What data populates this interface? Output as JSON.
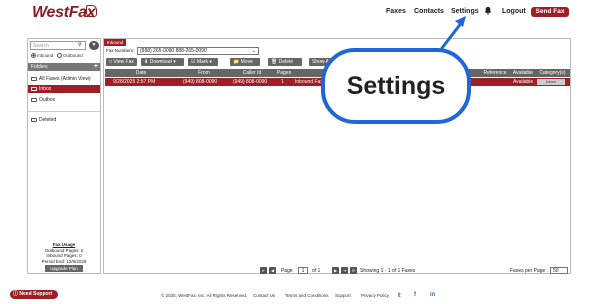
{
  "header": {
    "logo": "WestFax",
    "nav": {
      "faxes": "Faxes",
      "contacts": "Contacts",
      "settings": "Settings",
      "logout": "Logout"
    },
    "send_fax": "Send Fax",
    "bell_icon": "bell-icon"
  },
  "sidebar": {
    "search_placeholder": "Search",
    "inbound_label": "Inbound",
    "outbound_label": "Outbound",
    "folders_label": "Folders",
    "folders": [
      "All Faxes (Admin View)",
      "Inbox",
      "Outbox",
      "Deleted"
    ],
    "usage": {
      "title": "Fax Usage",
      "outbound": "Outbound Pages: 0",
      "inbound": "Inbound Pages: 0",
      "period_end": "Period End: 12/9/2025"
    },
    "upgrade": "Upgrade Plan"
  },
  "main": {
    "tab": "Inbound",
    "fax_numbers_label": "Fax Numbers:",
    "fax_number_selected": "(888) 265-0090 888-265-0090",
    "toolbar": {
      "view": "View Fax",
      "download": "Download",
      "mark": "Mark",
      "move": "Move",
      "delete": "Delete",
      "show_all": "Show All F"
    },
    "columns": [
      "Date",
      "From",
      "Caller Id",
      "Pages",
      "Reference",
      "Available",
      "Category(s)"
    ],
    "rows": [
      {
        "date": "9/28/2025 2:57 PM",
        "from": "(949) 808-0090",
        "caller_id": "(949) 808-0090",
        "pages": "1",
        "desc": "Inbound Fax to 8882650090",
        "available": "Available",
        "category": "Inbox"
      }
    ],
    "pager": {
      "page_label": "Page",
      "page": "1",
      "of": "of 1",
      "showing": "Showing 1 - 1 of 1 Faxes",
      "per_page_label": "Faxes per Page :",
      "per_page": "50"
    }
  },
  "footer": {
    "need_support": "Need Support",
    "copyright": "© 2025, WestFax, Inc. All Rights Reserved.",
    "links": [
      "Contact Us",
      "Terms and Conditions",
      "Support",
      "Privacy Policy"
    ]
  },
  "callout": {
    "text": "Settings"
  },
  "colors": {
    "brand": "#a01e25",
    "callout": "#1f66d6"
  }
}
